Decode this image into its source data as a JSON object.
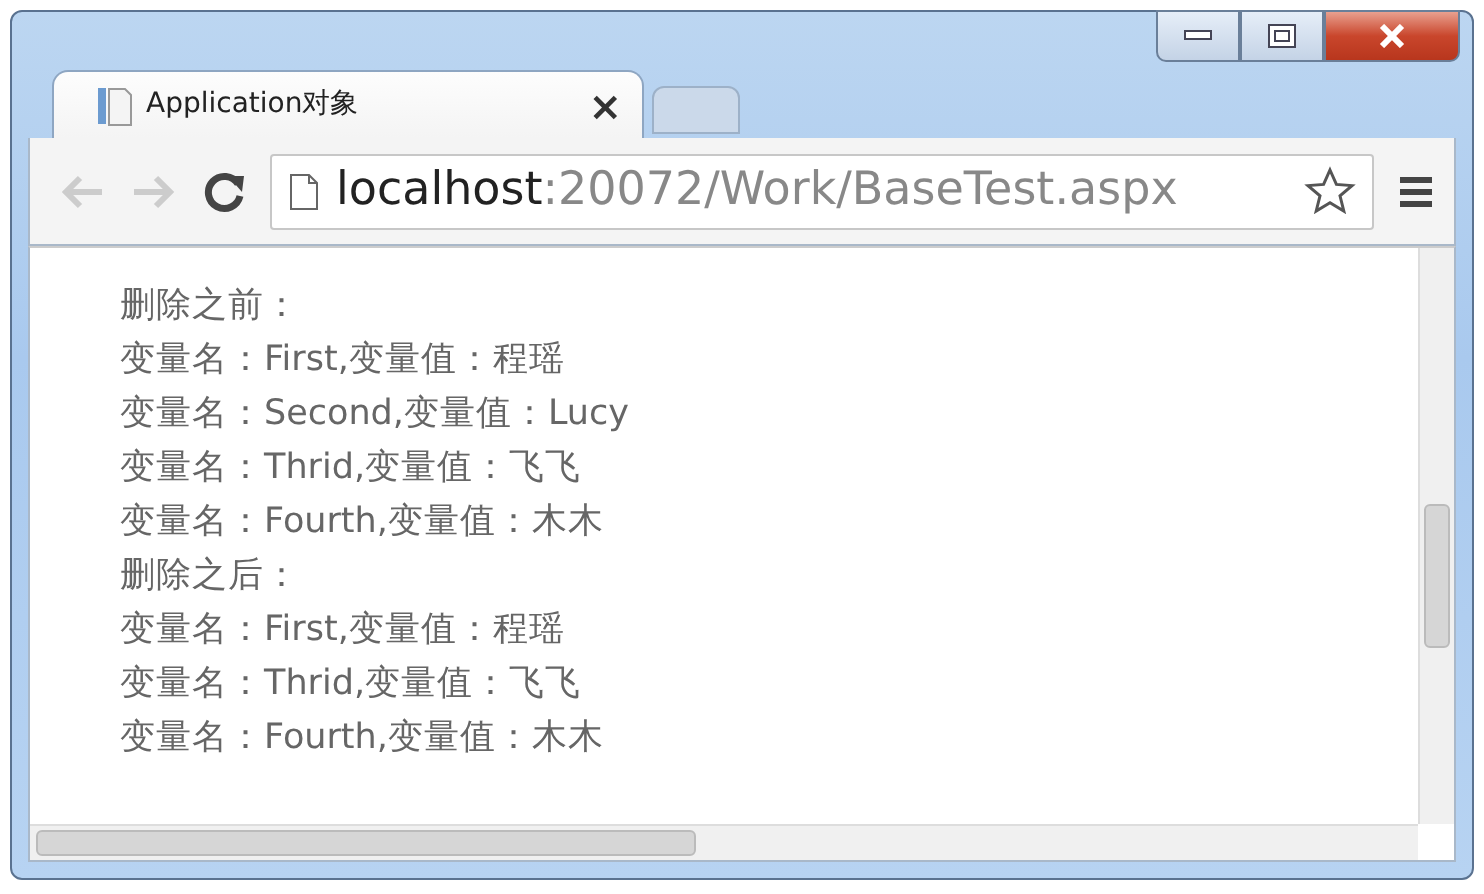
{
  "tabs": [
    {
      "title": "Application对象",
      "close": "×",
      "selected": true
    },
    {
      "selected": false
    }
  ],
  "address": {
    "host": "localhost",
    "path": ":20072/Work/BaseTest.aspx"
  },
  "content": {
    "lines": [
      "删除之前：",
      "变量名：First,变量值：程瑶",
      "变量名：Second,变量值：Lucy",
      "变量名：Thrid,变量值：飞飞",
      "变量名：Fourth,变量值：木木",
      "删除之后：",
      "变量名：First,变量值：程瑶",
      "变量名：Thrid,变量值：飞飞",
      "变量名：Fourth,变量值：木木"
    ]
  }
}
